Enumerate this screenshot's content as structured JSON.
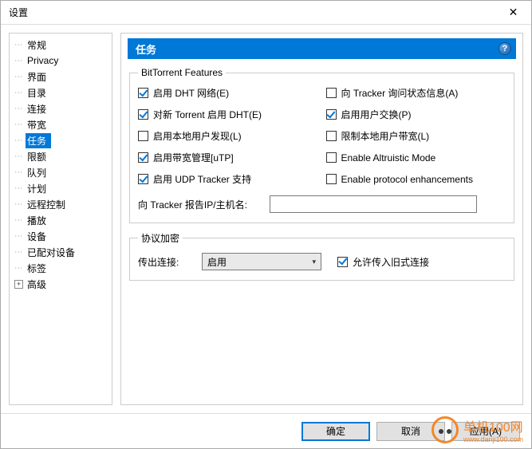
{
  "window": {
    "title": "设置"
  },
  "sidebar": {
    "items": [
      {
        "label": "常规"
      },
      {
        "label": "Privacy"
      },
      {
        "label": "界面"
      },
      {
        "label": "目录"
      },
      {
        "label": "连接"
      },
      {
        "label": "带宽"
      },
      {
        "label": "任务"
      },
      {
        "label": "限额"
      },
      {
        "label": "队列"
      },
      {
        "label": "计划"
      },
      {
        "label": "远程控制"
      },
      {
        "label": "播放"
      },
      {
        "label": "设备"
      },
      {
        "label": "已配对设备"
      },
      {
        "label": "标签"
      },
      {
        "label": "高级"
      }
    ],
    "selected_index": 6,
    "expandable_index": 15
  },
  "panel": {
    "title": "任务",
    "help": "?"
  },
  "bt_group": {
    "legend": "BitTorrent Features",
    "checks": [
      {
        "label": "启用 DHT 网络(E)",
        "checked": true
      },
      {
        "label": "向 Tracker 询问状态信息(A)",
        "checked": false
      },
      {
        "label": "对新 Torrent 启用 DHT(E)",
        "checked": true
      },
      {
        "label": "启用用户交换(P)",
        "checked": true
      },
      {
        "label": "启用本地用户发现(L)",
        "checked": false
      },
      {
        "label": "限制本地用户带宽(L)",
        "checked": false
      },
      {
        "label": "启用带宽管理[uTP]",
        "checked": true
      },
      {
        "label": "Enable Altruistic Mode",
        "checked": false
      },
      {
        "label": "启用 UDP Tracker 支持",
        "checked": true
      },
      {
        "label": "Enable protocol enhancements",
        "checked": false
      }
    ],
    "report_ip_label": "向 Tracker 报告IP/主机名:",
    "report_ip_value": ""
  },
  "enc_group": {
    "legend": "协议加密",
    "outgoing_label": "传出连接:",
    "outgoing_value": "启用",
    "allow_legacy": {
      "label": "允许传入旧式连接",
      "checked": true
    }
  },
  "footer": {
    "ok": "确定",
    "cancel": "取消",
    "apply": "应用(A)"
  },
  "watermark": {
    "text": "单机100网",
    "sub": "www.danji100.com"
  }
}
